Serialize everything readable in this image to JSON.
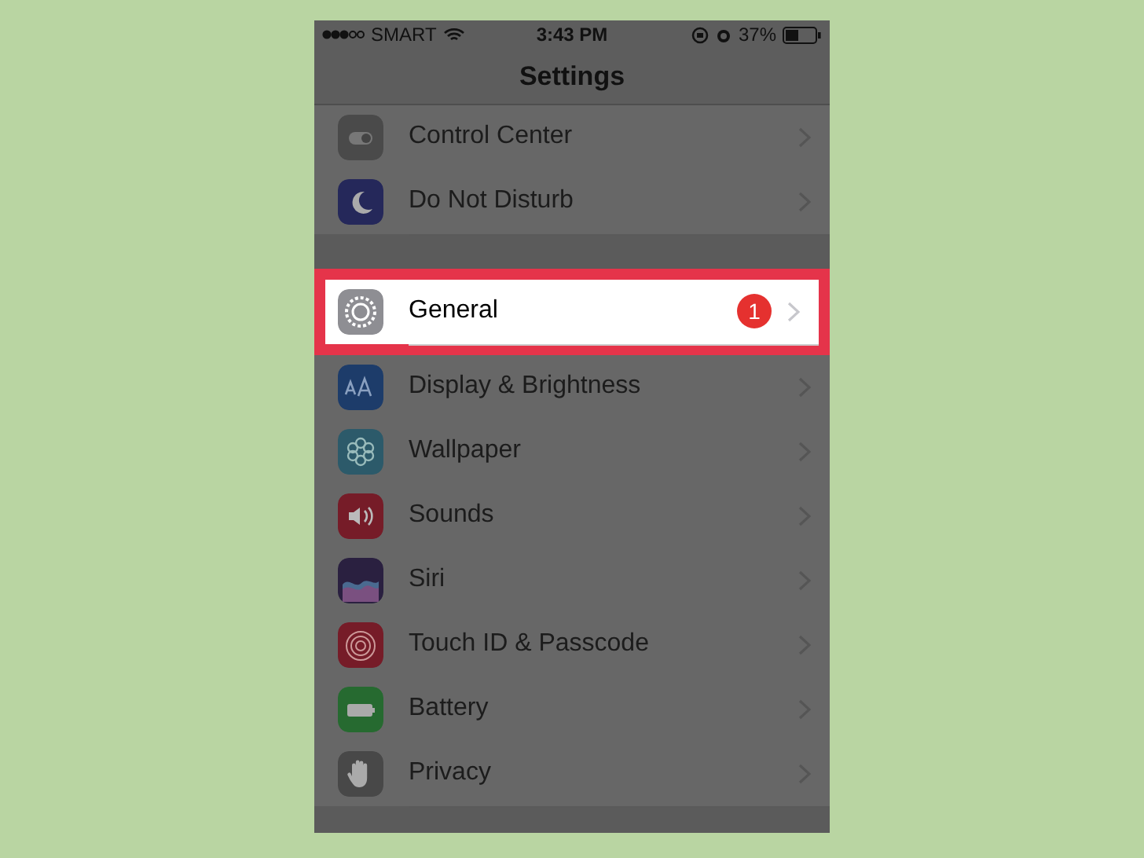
{
  "status_bar": {
    "carrier": "SMART",
    "time": "3:43 PM",
    "battery": "37%"
  },
  "nav": {
    "title": "Settings"
  },
  "groups": [
    {
      "rows": [
        {
          "label": "Control Center",
          "highlighted": false
        },
        {
          "label": "Do Not Disturb",
          "highlighted": false
        }
      ]
    },
    {
      "rows": [
        {
          "label": "General",
          "badge": "1",
          "highlighted": true
        },
        {
          "label": "Display & Brightness",
          "highlighted": false
        },
        {
          "label": "Wallpaper",
          "highlighted": false
        },
        {
          "label": "Sounds",
          "highlighted": false
        },
        {
          "label": "Siri",
          "highlighted": false
        },
        {
          "label": "Touch ID & Passcode",
          "highlighted": false
        },
        {
          "label": "Battery",
          "highlighted": false
        },
        {
          "label": "Privacy",
          "highlighted": false
        }
      ]
    }
  ]
}
